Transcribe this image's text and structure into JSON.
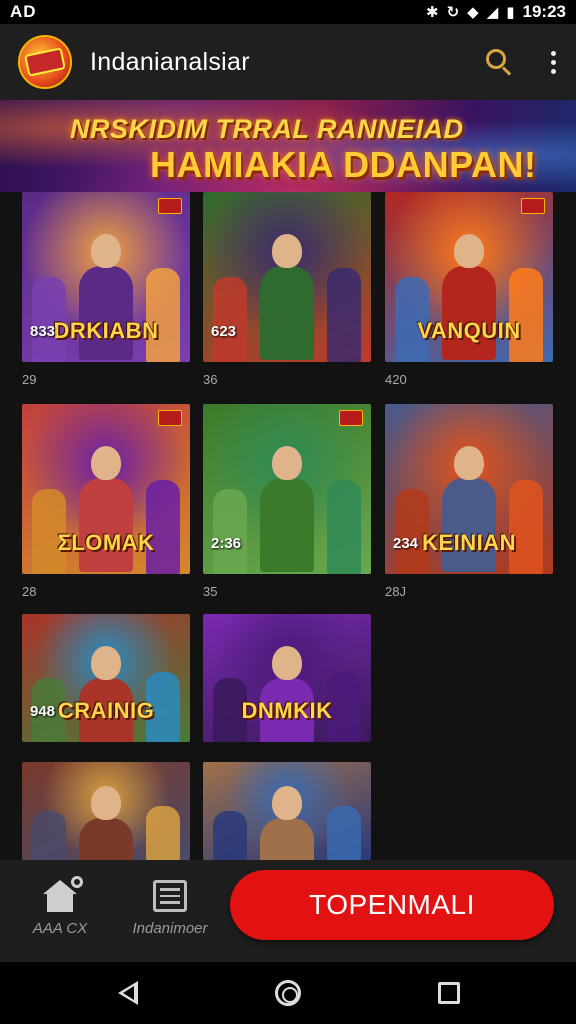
{
  "status_bar": {
    "left_text": "AD",
    "time": "19:23",
    "icons": [
      "bluetooth-icon",
      "vibrate-icon",
      "wifi-icon",
      "signal-icon",
      "battery-icon"
    ]
  },
  "app_bar": {
    "title": "Indanianalsiar",
    "actions": [
      "search-icon",
      "more-vert-icon"
    ]
  },
  "banner": {
    "line1": "NRSKIDIM TRRAL RANNEIAD",
    "line2": "HAMIAKIA DDANPAN!"
  },
  "games": [
    {
      "title": "DRKIABN",
      "number": "833",
      "caption": "29",
      "theme": [
        "#f0a040",
        "#5b2a86",
        "#7a3fb0"
      ]
    },
    {
      "title": "",
      "number": "623",
      "caption": "36",
      "theme": [
        "#3a2a6e",
        "#2f6b2e",
        "#c0392b"
      ]
    },
    {
      "title": "VANQUIN",
      "number": "",
      "caption": "420",
      "theme": [
        "#ff7a1a",
        "#b3261e",
        "#3d6ab3"
      ]
    },
    {
      "title": "ƩLOMAK",
      "number": "",
      "caption": "28",
      "theme": [
        "#6a1fa6",
        "#c04040",
        "#d48a2a"
      ]
    },
    {
      "title": "",
      "number": "2:36",
      "caption": "35",
      "theme": [
        "#2f8a56",
        "#3b7a2a",
        "#6aa84f"
      ]
    },
    {
      "title": "KEINIAN",
      "number": "234",
      "caption": "28J",
      "theme": [
        "#e0541d",
        "#4a5a8a",
        "#b33a1a"
      ]
    },
    {
      "title": "CRAINIG",
      "number": "948",
      "caption": "",
      "theme": [
        "#2a8ac0",
        "#a8342a",
        "#4a7a3a"
      ]
    },
    {
      "title": "DNMKIK",
      "number": "",
      "caption": "",
      "theme": [
        "#4a1a7a",
        "#7a2ab0",
        "#3a1a5a"
      ]
    },
    {
      "title": "",
      "number": "",
      "caption": "",
      "theme": [
        "#d8a040",
        "#7a3a2a",
        "#4a4a6a"
      ]
    },
    {
      "title": "",
      "number": "",
      "caption": "",
      "theme": [
        "#3a6ab0",
        "#a0704a",
        "#2a3a7a"
      ]
    }
  ],
  "bottom_bar": {
    "nav_home_label": "AAA CX",
    "nav_list_label": "Indanimoer",
    "cta_label": "TOPENMALI"
  }
}
